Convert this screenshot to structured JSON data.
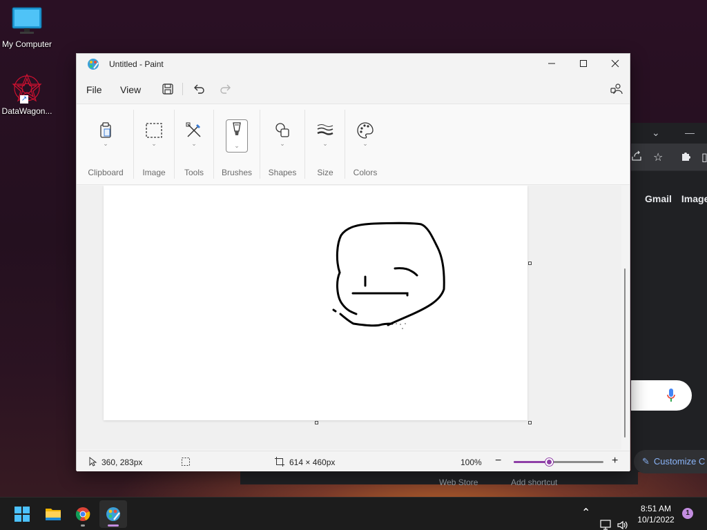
{
  "desktop": {
    "icons": [
      {
        "label": "My Computer",
        "icon": "monitor-icon"
      },
      {
        "label": "DataWagon...",
        "icon": "datawagon-logo-icon"
      }
    ]
  },
  "browser": {
    "titlebar_glyphs": [
      "chevron-down-icon",
      "minimize-icon"
    ],
    "toolbar_glyphs": [
      "share-icon",
      "star-icon",
      "extensions-icon"
    ],
    "links": [
      "Gmail",
      "Images"
    ],
    "customize_label": "Customize C",
    "bottom_shortcuts": [
      "Web Store",
      "Add shortcut"
    ]
  },
  "paint": {
    "title": "Untitled - Paint",
    "menu": [
      "File",
      "View"
    ],
    "menubar_icons": [
      "save-icon",
      "undo-icon",
      "redo-icon"
    ],
    "ribbon_groups": [
      {
        "label": "Clipboard",
        "icon": "clipboard-icon"
      },
      {
        "label": "Image",
        "icon": "selection-icon"
      },
      {
        "label": "Tools",
        "icon": "tools-icon"
      },
      {
        "label": "Brushes",
        "icon": "brush-icon"
      },
      {
        "label": "Shapes",
        "icon": "shapes-icon"
      },
      {
        "label": "Size",
        "icon": "size-icon"
      },
      {
        "label": "Colors",
        "icon": "palette-icon"
      }
    ],
    "status": {
      "cursor_position": "360, 283px",
      "canvas_size": "614 × 460px",
      "zoom": "100%",
      "zoom_level_fraction": 0.39
    }
  },
  "taskbar": {
    "apps": [
      "start-icon",
      "file-explorer-icon",
      "chrome-icon",
      "paint-icon"
    ],
    "tray": [
      "chevron-up-icon",
      "network-icon",
      "volume-icon"
    ],
    "time": "8:51 AM",
    "date": "10/1/2022",
    "notification_count": "1"
  },
  "colors": {
    "accent": "#8e3ea6",
    "chrome_blue": "#8ab4f8",
    "taskbar_bg": "#1c1c1c"
  }
}
